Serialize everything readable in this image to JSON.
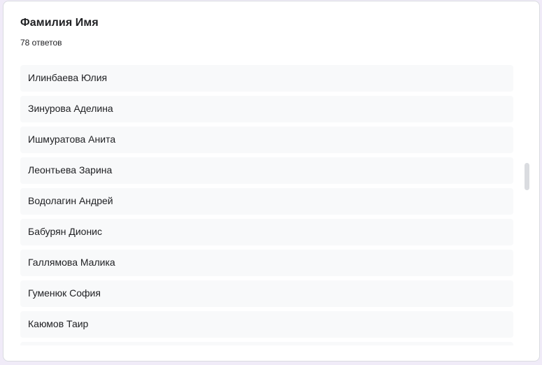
{
  "question": {
    "title": "Фамилия Имя",
    "response_count": "78 ответов"
  },
  "answers": [
    "Илинбаева Юлия",
    "Зинурова Аделина",
    "Ишмуратова Анита",
    "Леонтьева Зарина",
    "Водолагин Андрей",
    "Бабурян Дионис",
    "Галлямова Малика",
    "Гуменюк София",
    "Каюмов Таир",
    ""
  ],
  "colors": {
    "page_background": "#f0ebf8",
    "card_background": "#ffffff",
    "answer_background": "#f8f9fa",
    "text": "#202124",
    "scrollbar_thumb": "#dadce0"
  }
}
